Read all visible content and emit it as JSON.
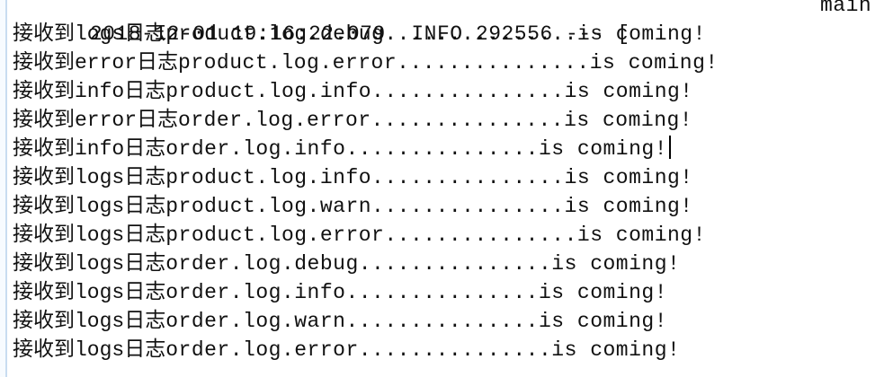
{
  "console": {
    "header": {
      "text": "2018-12-01 19:16:22.079  INFO 292556 --- [",
      "thread": "main"
    },
    "lines": [
      {
        "prefix": "接收到logs日志",
        "text": "product.log.debug...............is coming!"
      },
      {
        "prefix": "接收到error日志",
        "text": "product.log.error...............is coming!"
      },
      {
        "prefix": "接收到info日志",
        "text": "product.log.info...............is coming!"
      },
      {
        "prefix": "接收到error日志",
        "text": "order.log.error...............is coming!"
      },
      {
        "prefix": "接收到info日志",
        "text": "order.log.info...............is coming!"
      },
      {
        "prefix": "接收到logs日志",
        "text": "product.log.info...............is coming!"
      },
      {
        "prefix": "接收到logs日志",
        "text": "product.log.warn...............is coming!"
      },
      {
        "prefix": "接收到logs日志",
        "text": "product.log.error...............is coming!"
      },
      {
        "prefix": "接收到logs日志",
        "text": "order.log.debug...............is coming!"
      },
      {
        "prefix": "接收到logs日志",
        "text": "order.log.info...............is coming!"
      },
      {
        "prefix": "接收到logs日志",
        "text": "order.log.warn...............is coming!"
      },
      {
        "prefix": "接收到logs日志",
        "text": "order.log.error...............is coming!"
      }
    ]
  }
}
